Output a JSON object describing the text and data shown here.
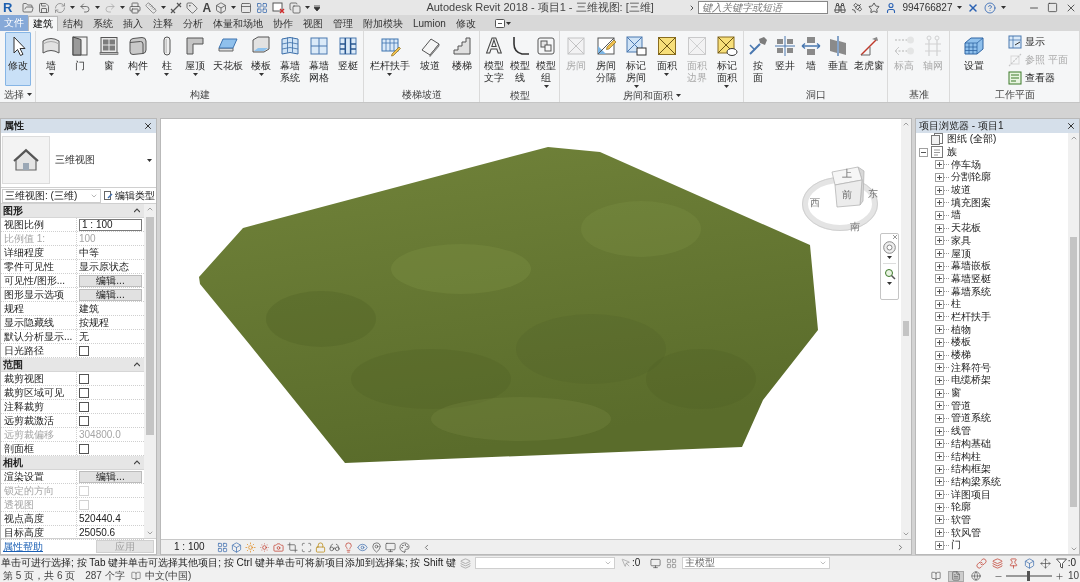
{
  "title_bar": {
    "logo": "R",
    "text_glyph": "A",
    "title": "Autodesk Revit 2018 - 项目1 - 三维视图: [三维]",
    "search": {
      "placeholder": "键入关键字或短语"
    },
    "user": "994766827"
  },
  "file_menu": "文件",
  "ribbon_tabs": [
    {
      "label": "建筑",
      "selected": true
    },
    {
      "label": "结构",
      "selected": false
    },
    {
      "label": "系统",
      "selected": false
    },
    {
      "label": "插入",
      "selected": false
    },
    {
      "label": "注释",
      "selected": false
    },
    {
      "label": "分析",
      "selected": false
    },
    {
      "label": "体量和场地",
      "selected": false
    },
    {
      "label": "协作",
      "selected": false
    },
    {
      "label": "视图",
      "selected": false
    },
    {
      "label": "管理",
      "selected": false
    },
    {
      "label": "附加模块",
      "selected": false
    },
    {
      "label": "Lumion",
      "selected": false
    },
    {
      "label": "修改",
      "selected": false
    }
  ],
  "ribbon_panels": [
    {
      "title": "选择",
      "menu": true,
      "tools": [
        {
          "label": "修改",
          "stacked": false,
          "selected": true,
          "disabled": false,
          "menu": false
        }
      ]
    },
    {
      "title": "构建",
      "menu": false,
      "tools": [
        {
          "label": "墙",
          "selected": false,
          "disabled": false,
          "menu": true
        },
        {
          "label": "门",
          "selected": false,
          "disabled": false,
          "menu": false
        },
        {
          "label": "窗",
          "selected": false,
          "disabled": false,
          "menu": false
        },
        {
          "label": "构件",
          "stacked": false,
          "selected": false,
          "disabled": false,
          "menu": true
        },
        {
          "label": "柱",
          "selected": false,
          "disabled": false,
          "menu": true
        },
        {
          "label": "屋顶",
          "stacked": false,
          "selected": false,
          "disabled": false,
          "menu": true
        },
        {
          "label": "天花板",
          "stacked": false,
          "selected": false,
          "disabled": false,
          "menu": false
        },
        {
          "label": "楼板",
          "stacked": false,
          "selected": false,
          "disabled": false,
          "menu": true
        },
        {
          "label": "幕墙系统",
          "stacked": true,
          "selected": false,
          "disabled": false,
          "menu": false
        },
        {
          "label": "幕墙网格",
          "stacked": true,
          "selected": false,
          "disabled": false,
          "menu": false
        },
        {
          "label": "竖梃",
          "stacked": false,
          "selected": false,
          "disabled": false,
          "menu": false
        }
      ]
    },
    {
      "title": "楼梯坡道",
      "menu": false,
      "tools": [
        {
          "label": "栏杆扶手",
          "stacked": false,
          "selected": false,
          "disabled": false,
          "menu": true
        },
        {
          "label": "坡道",
          "stacked": false,
          "selected": false,
          "disabled": false,
          "menu": false
        },
        {
          "label": "楼梯",
          "stacked": false,
          "selected": false,
          "disabled": false,
          "menu": false
        }
      ]
    },
    {
      "title": "模型",
      "menu": false,
      "tools": [
        {
          "label": "模型文字",
          "glyph": "A",
          "stacked": true,
          "selected": false,
          "disabled": false,
          "menu": false
        },
        {
          "label": "模型线",
          "stacked": true,
          "selected": false,
          "disabled": false,
          "menu": false
        },
        {
          "label": "模型组",
          "stacked": true,
          "selected": false,
          "disabled": false,
          "menu": true
        }
      ]
    },
    {
      "title": "房间和面积",
      "menu": true,
      "tools": [
        {
          "label": "房间",
          "stacked": false,
          "selected": false,
          "disabled": true,
          "menu": false
        },
        {
          "label": "房间分隔",
          "stacked": true,
          "selected": false,
          "disabled": false,
          "menu": false
        },
        {
          "label": "标记房间",
          "stacked": true,
          "selected": false,
          "disabled": false,
          "menu": true
        },
        {
          "label": "面积",
          "stacked": false,
          "selected": false,
          "disabled": false,
          "menu": true
        },
        {
          "label": "面积边界",
          "stacked": true,
          "selected": false,
          "disabled": true,
          "menu": false
        },
        {
          "label": "标记面积",
          "stacked": true,
          "selected": false,
          "disabled": false,
          "menu": true
        }
      ]
    },
    {
      "title": "洞口",
      "menu": false,
      "tools": [
        {
          "label": "按面",
          "stacked": true,
          "selected": false,
          "disabled": false,
          "menu": false
        },
        {
          "label": "竖井",
          "stacked": false,
          "selected": false,
          "disabled": false,
          "menu": false
        },
        {
          "label": "墙",
          "selected": false,
          "disabled": false,
          "menu": false
        },
        {
          "label": "垂直",
          "stacked": false,
          "selected": false,
          "disabled": false,
          "menu": false
        },
        {
          "label": "老虎窗",
          "stacked": false,
          "selected": false,
          "disabled": false,
          "menu": false
        }
      ]
    },
    {
      "title": "基准",
      "menu": false,
      "tools": [
        {
          "label": "标高",
          "stacked": false,
          "selected": false,
          "disabled": true,
          "menu": false
        },
        {
          "label": "轴网",
          "stacked": false,
          "selected": false,
          "disabled": true,
          "menu": false
        }
      ]
    },
    {
      "title": "工作平面",
      "menu": false,
      "tools": [
        {
          "label": "设置",
          "stacked": false,
          "selected": false,
          "disabled": false,
          "menu": false
        }
      ],
      "small_tools": [
        {
          "label": "显示",
          "disabled": false
        },
        {
          "label": "参照 平面",
          "disabled": true
        },
        {
          "label": "查看器",
          "disabled": false
        }
      ]
    }
  ],
  "properties": {
    "title": "属性",
    "type_name": "三维视图",
    "type_selector": "三维视图: (三维)",
    "edit_type": "编辑类型",
    "groups": [
      {
        "title": "图形",
        "expanded": true,
        "rows": [
          {
            "label": "视图比例",
            "kind": "input",
            "value": "1 : 100",
            "disabled": false
          },
          {
            "label": "比例值 1:",
            "kind": "text",
            "value": "100",
            "disabled": true
          },
          {
            "label": "详细程度",
            "kind": "text",
            "value": "中等",
            "disabled": false
          },
          {
            "label": "零件可见性",
            "kind": "text",
            "value": "显示原状态",
            "disabled": false
          },
          {
            "label": "可见性/图形...",
            "kind": "button",
            "value": "编辑...",
            "disabled": false
          },
          {
            "label": "图形显示选项",
            "kind": "button",
            "value": "编辑...",
            "disabled": false
          },
          {
            "label": "规程",
            "kind": "text",
            "value": "建筑",
            "disabled": false
          },
          {
            "label": "显示隐藏线",
            "kind": "text",
            "value": "按规程",
            "disabled": false
          },
          {
            "label": "默认分析显示...",
            "kind": "text",
            "value": "无",
            "disabled": false
          },
          {
            "label": "日光路径",
            "kind": "checkbox",
            "checked": false,
            "disabled": false
          }
        ]
      },
      {
        "title": "范围",
        "expanded": true,
        "rows": [
          {
            "label": "裁剪视图",
            "kind": "checkbox",
            "checked": false,
            "disabled": false
          },
          {
            "label": "裁剪区域可见",
            "kind": "checkbox",
            "checked": false,
            "disabled": false
          },
          {
            "label": "注释裁剪",
            "kind": "checkbox",
            "checked": false,
            "disabled": false
          },
          {
            "label": "远剪裁激活",
            "kind": "checkbox",
            "checked": false,
            "disabled": false
          },
          {
            "label": "远剪裁偏移",
            "kind": "text",
            "value": "304800.0",
            "disabled": true
          },
          {
            "label": "剖面框",
            "kind": "checkbox",
            "checked": false,
            "disabled": false
          }
        ]
      },
      {
        "title": "相机",
        "expanded": true,
        "rows": [
          {
            "label": "渲染设置",
            "kind": "button",
            "value": "编辑...",
            "disabled": false
          },
          {
            "label": "锁定的方向",
            "kind": "checkbox",
            "checked": false,
            "disabled": true
          },
          {
            "label": "透视图",
            "kind": "checkbox",
            "checked": false,
            "disabled": true
          },
          {
            "label": "视点高度",
            "kind": "text",
            "value": "520440.4",
            "disabled": false
          },
          {
            "label": "目标高度",
            "kind": "text",
            "value": "25050.6",
            "disabled": false
          }
        ]
      }
    ],
    "help_link": "属性帮助",
    "apply": {
      "label": "应用",
      "disabled": true
    }
  },
  "view": {
    "scale": "1 : 100",
    "view_cube": {
      "top": "上",
      "front": "前",
      "west": "西",
      "east": "东",
      "south": "南"
    }
  },
  "project_browser": {
    "title": "项目浏览器 - 项目1",
    "tree": [
      {
        "label": "图纸 (全部)",
        "kind": "sheets"
      },
      {
        "label": "族",
        "kind": "families",
        "expanded": true,
        "children": [
          {
            "label": "停车场",
            "expanded": false
          },
          {
            "label": "分割轮廓",
            "expanded": false
          },
          {
            "label": "坡道",
            "expanded": false
          },
          {
            "label": "填充图案",
            "expanded": false
          },
          {
            "label": "墙",
            "expanded": false
          },
          {
            "label": "天花板",
            "expanded": false
          },
          {
            "label": "家具",
            "expanded": false
          },
          {
            "label": "屋顶",
            "expanded": false
          },
          {
            "label": "幕墙嵌板",
            "expanded": false
          },
          {
            "label": "幕墙竖梃",
            "expanded": false
          },
          {
            "label": "幕墙系统",
            "expanded": false
          },
          {
            "label": "柱",
            "expanded": false
          },
          {
            "label": "栏杆扶手",
            "expanded": false
          },
          {
            "label": "植物",
            "expanded": false
          },
          {
            "label": "楼板",
            "expanded": false
          },
          {
            "label": "楼梯",
            "expanded": false
          },
          {
            "label": "注释符号",
            "expanded": false
          },
          {
            "label": "电缆桥架",
            "expanded": false
          },
          {
            "label": "窗",
            "expanded": false
          },
          {
            "label": "管道",
            "expanded": false
          },
          {
            "label": "管道系统",
            "expanded": false
          },
          {
            "label": "线管",
            "expanded": false
          },
          {
            "label": "结构基础",
            "expanded": false
          },
          {
            "label": "结构柱",
            "expanded": false
          },
          {
            "label": "结构框架",
            "expanded": false
          },
          {
            "label": "结构梁系统",
            "expanded": false
          },
          {
            "label": "详图项目",
            "expanded": false
          },
          {
            "label": "轮廓",
            "expanded": false
          },
          {
            "label": "软管",
            "expanded": false
          },
          {
            "label": "软风管",
            "expanded": false
          },
          {
            "label": "门",
            "expanded": false
          }
        ]
      }
    ]
  },
  "status_bar": {
    "hint": "单击可进行选择; 按 Tab 键并单击可选择其他项目; 按 Ctrl 键并单击可将新项目添加到选择集; 按 Shift 键",
    "selection_count": ":0",
    "model": "主模型",
    "filter_count": ":0"
  },
  "document_status": {
    "page": "第 5 页，共 6 页",
    "words": "287 个字",
    "language": "中文(中国)",
    "view_buttons": [
      {
        "selected": false
      },
      {
        "selected": true
      },
      {
        "selected": false
      }
    ],
    "zoom": {
      "level": 0.5,
      "reading": "10"
    }
  }
}
